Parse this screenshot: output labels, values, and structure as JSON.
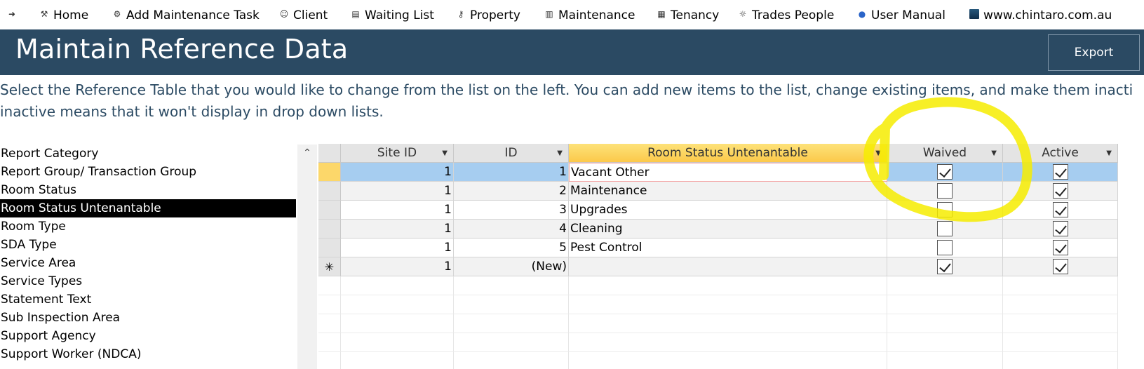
{
  "nav": {
    "items": [
      {
        "label": "Home",
        "icon": "home-icon"
      },
      {
        "label": "Add Maintenance Task",
        "icon": "task-icon"
      },
      {
        "label": "Client",
        "icon": "client-icon"
      },
      {
        "label": "Waiting List",
        "icon": "list-icon"
      },
      {
        "label": "Property",
        "icon": "key-icon"
      },
      {
        "label": "Maintenance",
        "icon": "trash-icon"
      },
      {
        "label": "Tenancy",
        "icon": "building-icon"
      },
      {
        "label": "Trades People",
        "icon": "worker-icon"
      },
      {
        "label": "User Manual",
        "icon": "help-icon"
      },
      {
        "label": "www.chintaro.com.au",
        "icon": "logo-icon"
      }
    ]
  },
  "header": {
    "title": "Maintain Reference Data",
    "export_label": "Export",
    "accent": "#2b4a63"
  },
  "instructions": {
    "line1": "Select the Reference Table that you would like to change from the list on the left. You can add new items to the list, change existing items, and make them inacti",
    "line2": "inactive means that it won't display in drop down lists."
  },
  "ref_list": {
    "items": [
      "Report Category",
      "Report Group/ Transaction Group",
      "Room Status",
      "Room Status Untenantable",
      "Room Type",
      "SDA Type",
      "Service Area",
      "Service Types",
      "Statement Text",
      "Sub Inspection Area",
      "Support Agency",
      "Support Worker (NDCA)"
    ],
    "selected": "Room Status Untenantable"
  },
  "grid": {
    "columns": [
      "Site ID",
      "ID",
      "Room Status Untenantable",
      "Waived",
      "Active"
    ],
    "rows": [
      {
        "site_id": "1",
        "id": "1",
        "name": "Vacant Other",
        "waived": true,
        "active": true
      },
      {
        "site_id": "1",
        "id": "2",
        "name": "Maintenance",
        "waived": false,
        "active": true
      },
      {
        "site_id": "1",
        "id": "3",
        "name": "Upgrades",
        "waived": false,
        "active": true
      },
      {
        "site_id": "1",
        "id": "4",
        "name": "Cleaning",
        "waived": false,
        "active": true
      },
      {
        "site_id": "1",
        "id": "5",
        "name": "Pest Control",
        "waived": false,
        "active": true
      }
    ],
    "new_row": {
      "site_id": "1",
      "id": "(New)",
      "name": "",
      "waived": true,
      "active": true
    },
    "new_row_marker": "✳"
  },
  "annotation_color": "#f6ec00"
}
